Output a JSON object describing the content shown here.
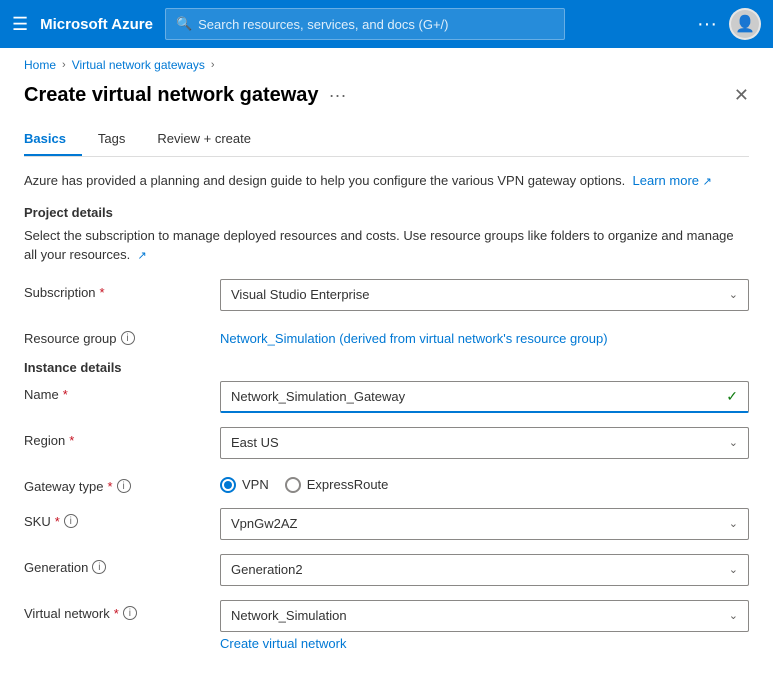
{
  "nav": {
    "hamburger": "☰",
    "brand": "Microsoft Azure",
    "search_placeholder": "Search resources, services, and docs (G+/)",
    "dots": "···",
    "avatar_icon": "👤"
  },
  "breadcrumb": {
    "home": "Home",
    "parent": "Virtual network gateways"
  },
  "page": {
    "title": "Create virtual network gateway",
    "title_dots": "···",
    "close": "✕"
  },
  "tabs": [
    {
      "label": "Basics",
      "active": true
    },
    {
      "label": "Tags",
      "active": false
    },
    {
      "label": "Review + create",
      "active": false
    }
  ],
  "info_text": "Azure has provided a planning and design guide to help you configure the various VPN gateway options.",
  "learn_more": "Learn more",
  "sections": {
    "project": {
      "header": "Project details",
      "description": "Select the subscription to manage deployed resources and costs. Use resource groups like folders to organize and manage all your resources."
    },
    "instance": {
      "header": "Instance details"
    }
  },
  "fields": {
    "subscription": {
      "label": "Subscription",
      "required": true,
      "value": "Visual Studio Enterprise"
    },
    "resource_group": {
      "label": "Resource group",
      "value": "Network_Simulation (derived from virtual network's resource group)"
    },
    "name": {
      "label": "Name",
      "required": true,
      "value": "Network_Simulation_Gateway"
    },
    "region": {
      "label": "Region",
      "required": true,
      "value": "East US"
    },
    "gateway_type": {
      "label": "Gateway type",
      "required": true,
      "options": [
        "VPN",
        "ExpressRoute"
      ],
      "selected": "VPN"
    },
    "sku": {
      "label": "SKU",
      "required": true,
      "value": "VpnGw2AZ"
    },
    "generation": {
      "label": "Generation",
      "value": "Generation2"
    },
    "virtual_network": {
      "label": "Virtual network",
      "required": true,
      "value": "Network_Simulation",
      "create_link": "Create virtual network"
    }
  }
}
